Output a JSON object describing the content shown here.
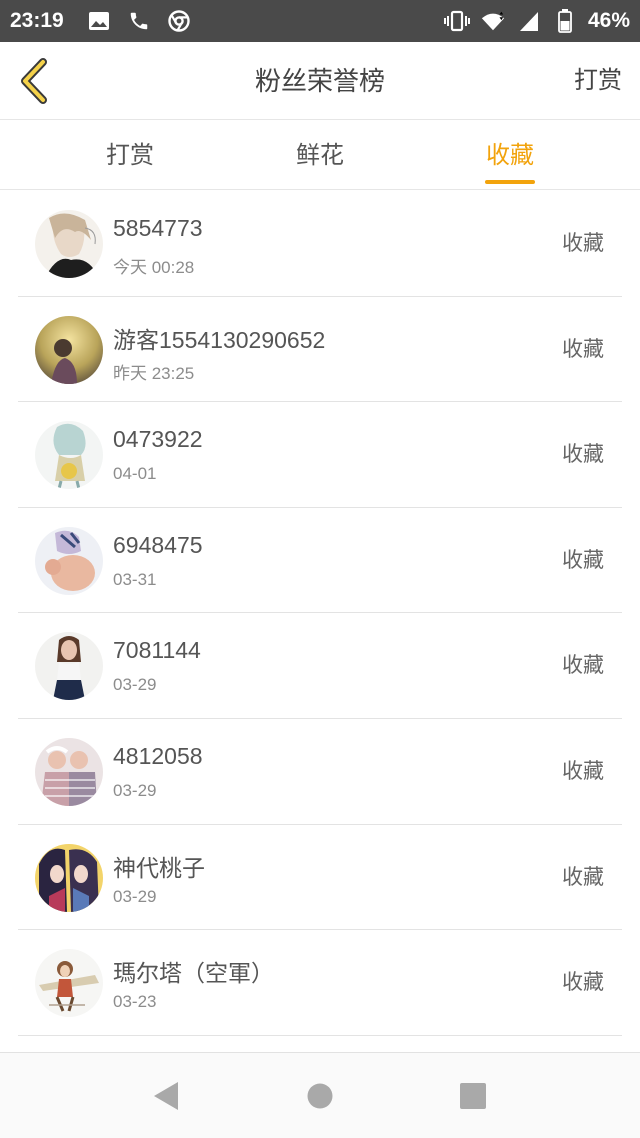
{
  "status_bar": {
    "time": "23:19",
    "battery": "46%",
    "icons": [
      "image-icon",
      "phone-icon",
      "chrome-icon",
      "vibrate-icon",
      "wifi-icon",
      "signal-icon",
      "battery-icon"
    ]
  },
  "header": {
    "title": "粉丝荣誉榜",
    "action_label": "打赏",
    "back_icon": "chevron-left-icon",
    "accent_color": "#f2a30c"
  },
  "tabs": [
    {
      "label": "打赏",
      "active": false
    },
    {
      "label": "鲜花",
      "active": false
    },
    {
      "label": "收藏",
      "active": true
    }
  ],
  "fans": [
    {
      "name": "5854773",
      "time": "今天 00:28",
      "action": "收藏"
    },
    {
      "name": "游客1554130290652",
      "time": "昨天 23:25",
      "action": "收藏"
    },
    {
      "name": "0473922",
      "time": "04-01",
      "action": "收藏"
    },
    {
      "name": "6948475",
      "time": "03-31",
      "action": "收藏"
    },
    {
      "name": "7081144",
      "time": "03-29",
      "action": "收藏"
    },
    {
      "name": "4812058",
      "time": "03-29",
      "action": "收藏"
    },
    {
      "name": "神代桃子",
      "time": "03-29",
      "action": "收藏"
    },
    {
      "name": "瑪尔塔（空軍）",
      "time": "03-23",
      "action": "收藏"
    }
  ],
  "nav_bar": {
    "icons": [
      "nav-back-icon",
      "nav-home-icon",
      "nav-recent-icon"
    ]
  }
}
